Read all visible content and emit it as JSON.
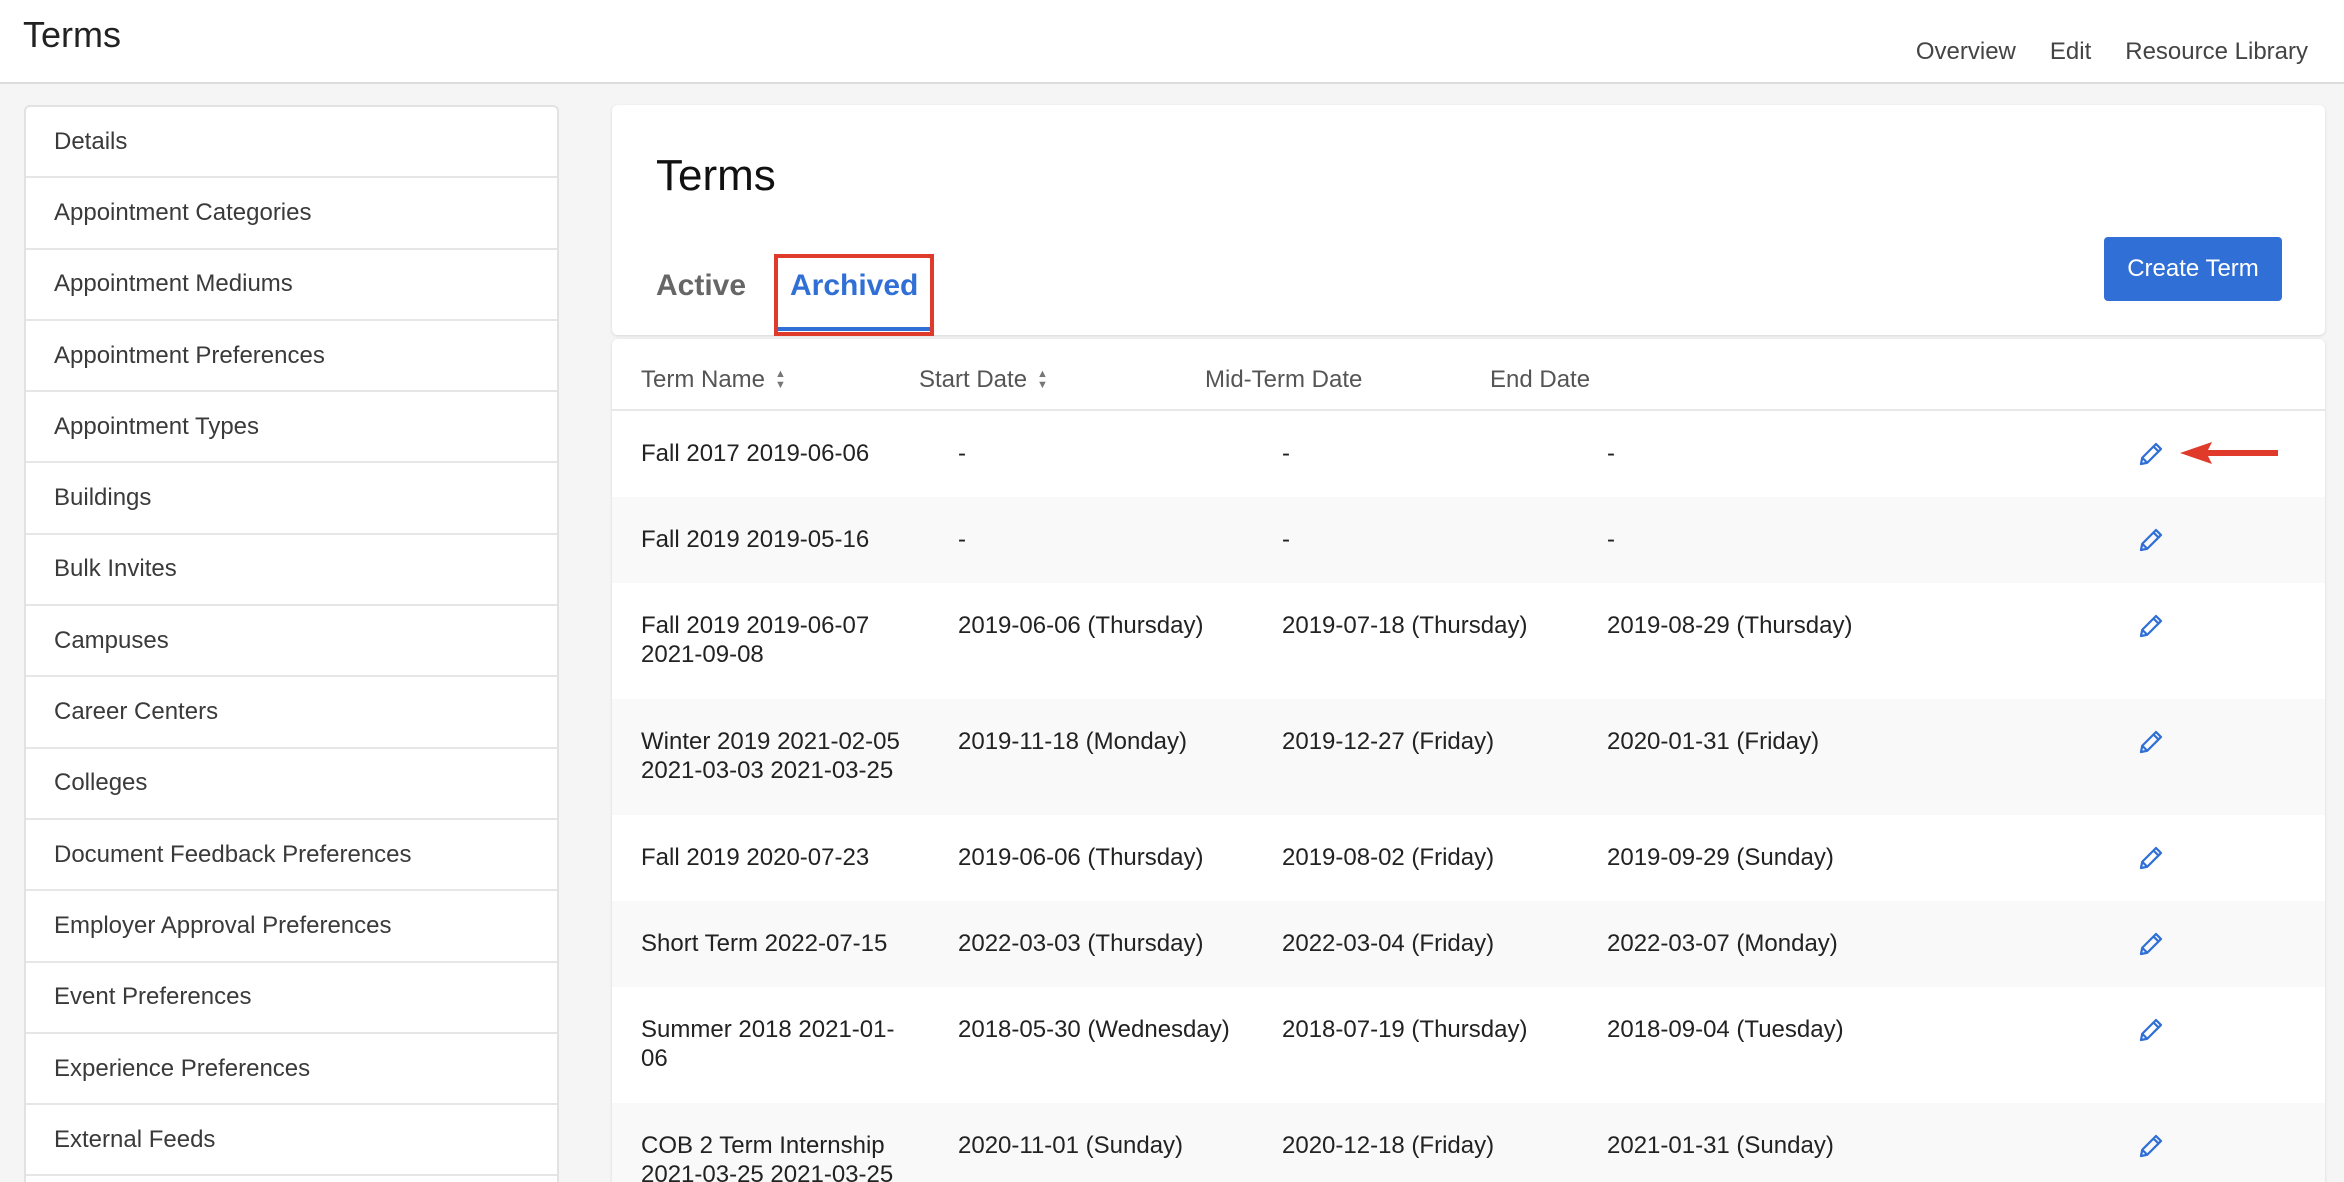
{
  "app": {
    "title": "Terms",
    "nav": [
      "Overview",
      "Edit",
      "Resource Library"
    ]
  },
  "sidebar": {
    "items": [
      "Details",
      "Appointment Categories",
      "Appointment Mediums",
      "Appointment Preferences",
      "Appointment Types",
      "Buildings",
      "Bulk Invites",
      "Campuses",
      "Career Centers",
      "Colleges",
      "Document Feedback Preferences",
      "Employer Approval Preferences",
      "Event Preferences",
      "Experience Preferences",
      "External Feeds"
    ]
  },
  "main": {
    "title": "Terms",
    "tabs": [
      {
        "label": "Active",
        "selected": false
      },
      {
        "label": "Archived",
        "selected": true
      }
    ],
    "create_button": "Create Term"
  },
  "table": {
    "columns": [
      "Term Name",
      "Start Date",
      "Mid-Term Date",
      "End Date"
    ],
    "sortable": [
      true,
      true,
      false,
      false
    ],
    "rows": [
      {
        "name": "Fall 2017 2019-06-06",
        "start": "-",
        "mid": "-",
        "end": "-"
      },
      {
        "name": "Fall 2019 2019-05-16",
        "start": "-",
        "mid": "-",
        "end": "-"
      },
      {
        "name": "Fall 2019 2019-06-07 2021-09-08",
        "start": "2019-06-06 (Thursday)",
        "mid": "2019-07-18 (Thursday)",
        "end": "2019-08-29 (Thursday)"
      },
      {
        "name": "Winter 2019 2021-02-05 2021-03-03 2021-03-25",
        "start": "2019-11-18 (Monday)",
        "mid": "2019-12-27 (Friday)",
        "end": "2020-01-31 (Friday)"
      },
      {
        "name": "Fall 2019 2020-07-23",
        "start": "2019-06-06 (Thursday)",
        "mid": "2019-08-02 (Friday)",
        "end": "2019-09-29 (Sunday)"
      },
      {
        "name": "Short Term 2022-07-15",
        "start": "2022-03-03 (Thursday)",
        "mid": "2022-03-04 (Friday)",
        "end": "2022-03-07 (Monday)"
      },
      {
        "name": "Summer 2018 2021-01-06",
        "start": "2018-05-30 (Wednesday)",
        "mid": "2018-07-19 (Thursday)",
        "end": "2018-09-04 (Tuesday)"
      },
      {
        "name": "COB 2 Term Internship 2021-03-25 2021-03-25",
        "start": "2020-11-01 (Sunday)",
        "mid": "2020-12-18 (Friday)",
        "end": "2021-01-31 (Sunday)"
      }
    ]
  },
  "colors": {
    "accent": "#2f6fd6",
    "annotation": "#e03a2b"
  },
  "icons": {
    "row_action": "pencil-edit-icon",
    "sort": "sort-icon",
    "annotation": "red-arrow-icon"
  }
}
